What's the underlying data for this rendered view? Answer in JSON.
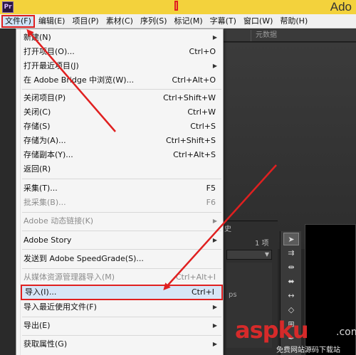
{
  "app": {
    "icon_text": "Pr",
    "title": "Ado"
  },
  "menubar": [
    "文件(F)",
    "编辑(E)",
    "项目(P)",
    "素材(C)",
    "序列(S)",
    "标记(M)",
    "字幕(T)",
    "窗口(W)",
    "帮助(H)"
  ],
  "workspace": {
    "tab_metadata": "元数据",
    "tab_history": "史",
    "item_count": "1 项",
    "ps_text": "ps"
  },
  "file_menu": {
    "items": [
      {
        "label": "新建(N)",
        "submenu": true
      },
      {
        "label": "打开项目(O)...",
        "shortcut": "Ctrl+O"
      },
      {
        "label": "打开最近项目(J)",
        "submenu": true
      },
      {
        "label": "在 Adobe Bridge 中浏览(W)...",
        "shortcut": "Ctrl+Alt+O"
      },
      {
        "label": "关闭项目(P)",
        "shortcut": "Ctrl+Shift+W"
      },
      {
        "label": "关闭(C)",
        "shortcut": "Ctrl+W"
      },
      {
        "label": "存储(S)",
        "shortcut": "Ctrl+S"
      },
      {
        "label": "存储为(A)...",
        "shortcut": "Ctrl+Shift+S"
      },
      {
        "label": "存储副本(Y)...",
        "shortcut": "Ctrl+Alt+S"
      },
      {
        "label": "返回(R)"
      },
      {
        "label": "采集(T)...",
        "shortcut": "F5"
      },
      {
        "label": "批采集(B)...",
        "shortcut": "F6",
        "disabled": true
      },
      {
        "label": "Adobe 动态链接(K)",
        "submenu": true,
        "disabled": true
      },
      {
        "label": "Adobe Story",
        "submenu": true
      },
      {
        "label": "发送到 Adobe SpeedGrade(S)..."
      },
      {
        "label": "从媒体资源管理器导入(M)",
        "shortcut": "Ctrl+Alt+I",
        "disabled": true
      },
      {
        "label": "导入(I)...",
        "shortcut": "Ctrl+I",
        "highlighted": true
      },
      {
        "label": "导入最近使用文件(F)",
        "submenu": true
      },
      {
        "label": "导出(E)",
        "submenu": true
      },
      {
        "label": "获取属性(G)",
        "submenu": true
      }
    ]
  },
  "watermark": {
    "logo": "aspku",
    "domain_suffix": ".com",
    "subtitle": "免费网站源码下载站"
  },
  "colors": {
    "annotation_red": "#e02020",
    "highlight_bg": "#d7e6f7",
    "title_bar": "#f3d23c"
  }
}
